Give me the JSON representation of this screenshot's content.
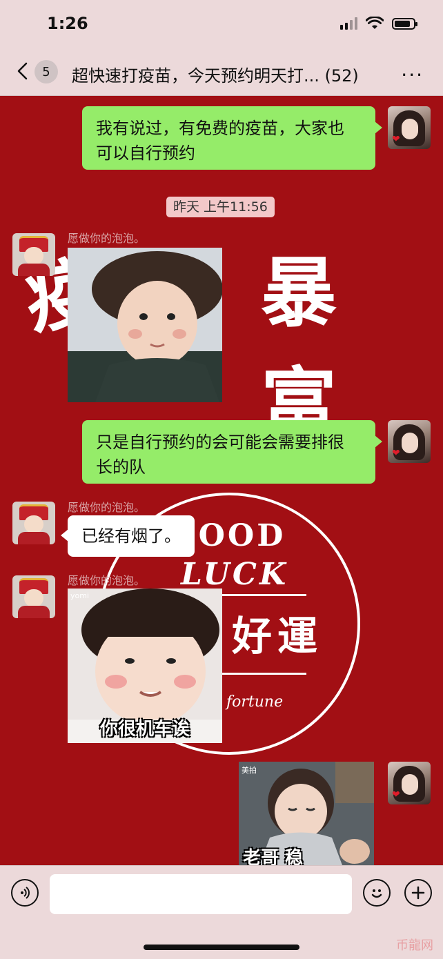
{
  "status_bar": {
    "time": "1:26",
    "battery_level": 0.85
  },
  "nav": {
    "unread_count": "5",
    "title": "超快速打疫苗，今天预约明天打... (52)",
    "more_label": "···"
  },
  "background": {
    "deco_left": "疫",
    "deco_right": "暴富",
    "good": "GOOD",
    "luck": "LUCK",
    "haoyun": "好運",
    "fortune": "fortune"
  },
  "messages": [
    {
      "from": "me",
      "type": "text",
      "text_line1": "我有说过，有免费的疫苗，大家也",
      "text_line2": "可以自行预约"
    },
    {
      "type": "timestamp",
      "text": "昨天 上午11:56"
    },
    {
      "from": "other",
      "sender": "愿做你的泡泡。",
      "type": "sticker"
    },
    {
      "from": "me",
      "type": "text",
      "text_line1": "只是自行预约的会可能会需要排很",
      "text_line2": "长的队"
    },
    {
      "from": "other",
      "sender": "愿做你的泡泡。",
      "type": "text",
      "text": "已经有烟了。"
    },
    {
      "from": "other",
      "sender": "愿做你的泡泡。",
      "type": "sticker",
      "caption": "你很机车诶",
      "tag": "yomi"
    },
    {
      "from": "me",
      "type": "sticker",
      "tag": "美拍",
      "caption": "老哥 稳"
    }
  ],
  "watermark": "币龍网"
}
